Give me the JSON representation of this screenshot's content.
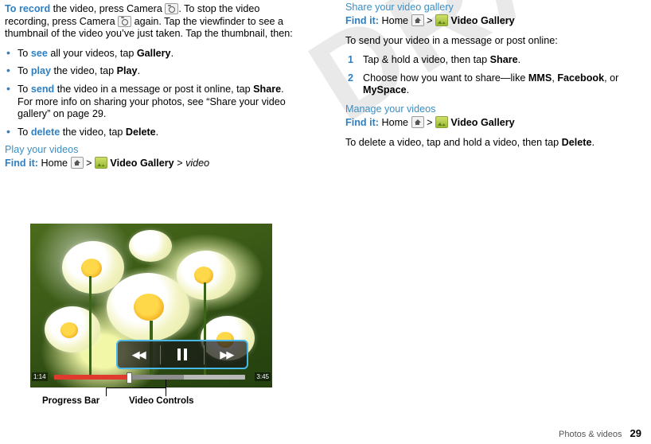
{
  "watermark": "DRAFT",
  "left_column": {
    "intro": {
      "lead": "To record",
      "text_1": " the video, press Camera ",
      "text_2": ". To stop the video recording, press Camera ",
      "text_3": " again. Tap the viewfinder to see a thumbnail of the video you’ve just taken. Tap the thumbnail, then:"
    },
    "bullets": [
      {
        "pre": "To ",
        "verb": "see",
        "mid": " all your videos, tap ",
        "bold": "Gallery",
        "post": "."
      },
      {
        "pre": "To ",
        "verb": "play",
        "mid": " the video, tap ",
        "bold": "Play",
        "post": "."
      },
      {
        "pre": "To ",
        "verb": "send",
        "mid": " the video in a message or post it online, tap ",
        "bold": "Share",
        "post": ". For more info on sharing your photos, see “Share your video gallery” on page 29."
      },
      {
        "pre": "To ",
        "verb": "delete",
        "mid": " the video, tap ",
        "bold": "Delete",
        "post": "."
      }
    ],
    "section_heading": "Play your videos",
    "findit_label": "Find it:",
    "findit_home": "Home",
    "findit_sep": ">",
    "findit_gallery": "Video Gallery",
    "findit_sep2": ">",
    "findit_video": "video"
  },
  "right_column": {
    "heading_1": "Share your video gallery",
    "findit_label": "Find it:",
    "findit_home": "Home",
    "findit_sep": ">",
    "findit_gallery": "Video Gallery",
    "para_1": "To send your video in a message or post online:",
    "steps": [
      {
        "num": "1",
        "pre": "Tap & hold a video, then tap ",
        "bold": "Share",
        "post": "."
      },
      {
        "num": "2",
        "pre": "Choose how you want to share—like ",
        "bold": "MMS",
        "mid": ", ",
        "bold2": "Facebook",
        "mid2": ", or ",
        "bold3": "MySpace",
        "post": "."
      }
    ],
    "heading_2": "Manage your videos",
    "findit_label_2": "Find it:",
    "findit_home_2": "Home",
    "findit_sep_2": ">",
    "findit_gallery_2": "Video Gallery",
    "para_2_pre": "To delete a video, tap and hold a video, then tap ",
    "para_2_bold": "Delete",
    "para_2_post": "."
  },
  "figure": {
    "time_elapsed": "1:14",
    "time_total": "3:45",
    "rewind_icon": "◀◀",
    "pause_icon": "pause",
    "forward_icon": "▶▶",
    "label_progress": "Progress Bar",
    "label_controls": "Video Controls"
  },
  "footer": {
    "section": "Photos & videos",
    "page": "29"
  },
  "colors": {
    "accent_blue": "#2f7fc1",
    "heading_blue": "#3a8ec4",
    "control_border": "#49b7e8",
    "progress_red": "#e03a2f"
  }
}
